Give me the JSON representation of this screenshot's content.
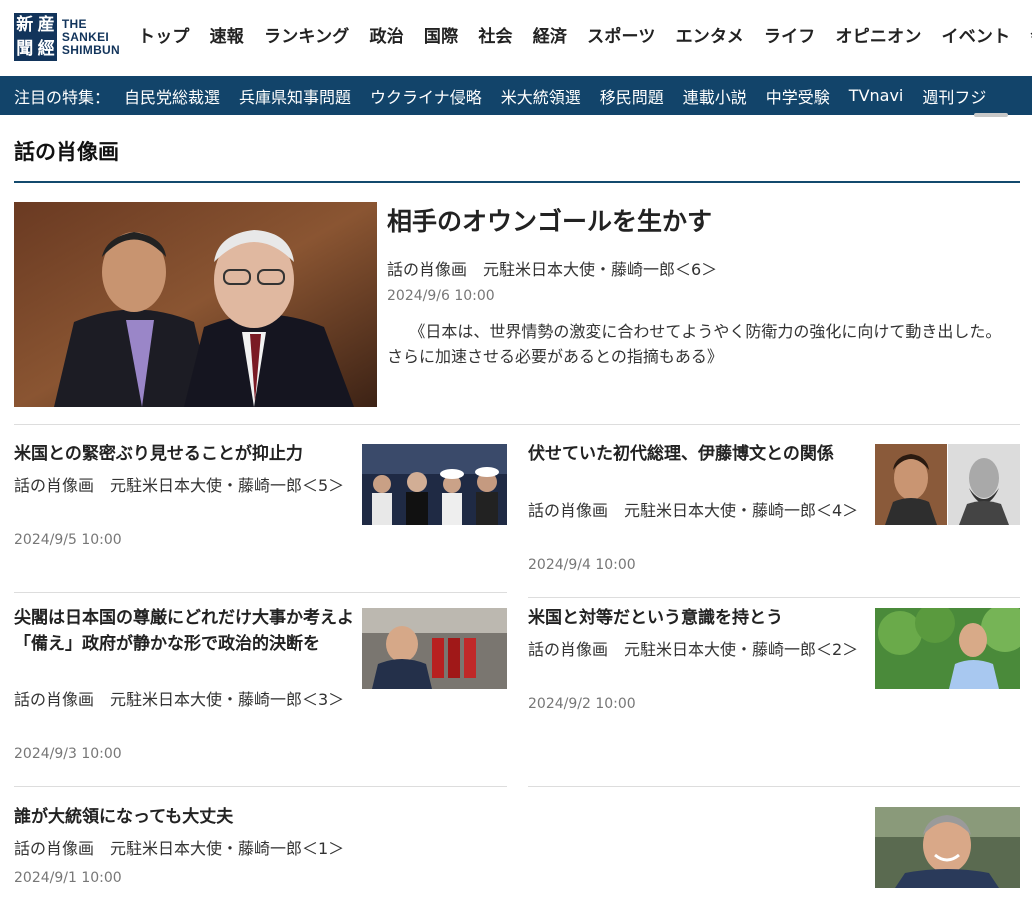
{
  "header": {
    "logo_kanji": [
      "新",
      "産",
      "聞",
      "經"
    ],
    "logo_lines": [
      "THE",
      "SANKEI",
      "SHIMBUN"
    ],
    "nav": [
      "トップ",
      "速報",
      "ランキング",
      "政治",
      "国際",
      "社会",
      "経済",
      "スポーツ",
      "エンタメ",
      "ライフ",
      "オピニオン",
      "イベント",
      "会員"
    ]
  },
  "feature_bar": {
    "label": "注目の特集：",
    "items": [
      "自民党総裁選",
      "兵庫県知事問題",
      "ウクライナ侵略",
      "米大統領選",
      "移民問題",
      "連載小説",
      "中学受験",
      "TVnavi",
      "週刊フジ"
    ]
  },
  "section": {
    "title": "話の肖像画"
  },
  "lead": {
    "title": "相手のオウンゴールを生かす",
    "series": "話の肖像画　元駐米日本大使・藤崎一郎＜6＞",
    "date": "2024/9/6 10:00",
    "summary": "《日本は、世界情勢の激変に合わせてようやく防衛力の強化に向けて動き出した。さらに加速させる必要があるとの指摘もある》"
  },
  "articles": [
    {
      "title": "米国との緊密ぶり見せることが抑止力",
      "series": "話の肖像画　元駐米日本大使・藤崎一郎＜5＞",
      "date": "2024/9/5 10:00"
    },
    {
      "title": "伏せていた初代総理、伊藤博文との関係",
      "series": "話の肖像画　元駐米日本大使・藤崎一郎＜4＞",
      "date": "2024/9/4 10:00"
    },
    {
      "title": "尖閣は日本国の尊厳にどれだけ大事か考えよ　「備え」政府が静かな形で政治的決断を",
      "series": "話の肖像画　元駐米日本大使・藤崎一郎＜3＞",
      "date": "2024/9/3 10:00"
    },
    {
      "title": "米国と対等だという意識を持とう",
      "series": "話の肖像画　元駐米日本大使・藤崎一郎＜2＞",
      "date": "2024/9/2 10:00"
    },
    {
      "title": "誰が大統領になっても大丈夫",
      "series": "話の肖像画　元駐米日本大使・藤崎一郎＜1＞",
      "date": "2024/9/1 10:00"
    }
  ],
  "colors": {
    "brand_navy": "#12345b",
    "feature_bar": "#12446a",
    "rule": "#134a6d"
  }
}
